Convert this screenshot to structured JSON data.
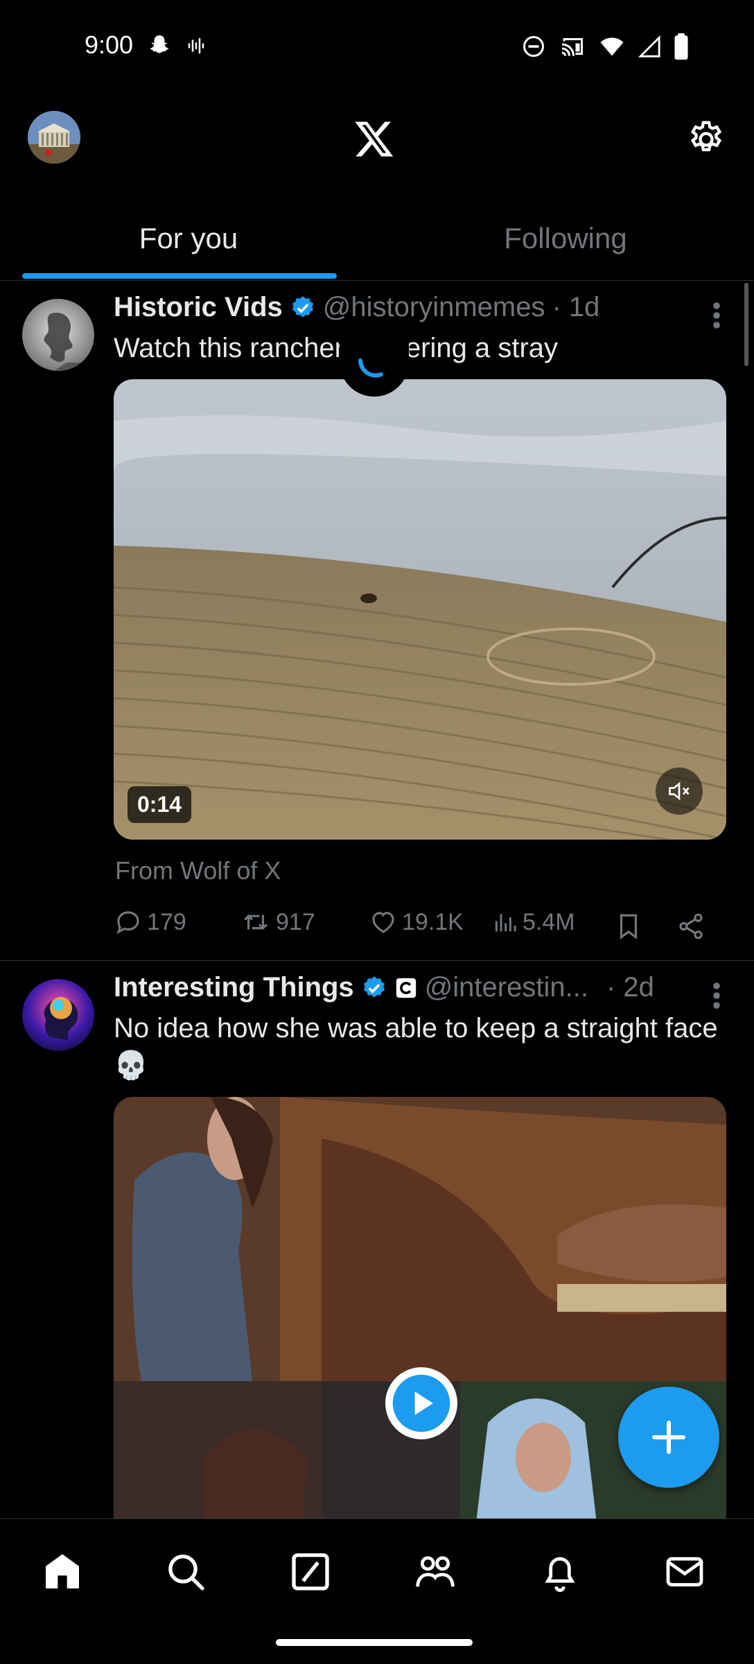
{
  "status_bar": {
    "time": "9:00"
  },
  "header": {
    "logo": "x-logo-icon",
    "settings": "gear-icon"
  },
  "tabs": [
    {
      "label": "For you",
      "active": true
    },
    {
      "label": "Following",
      "active": false
    }
  ],
  "tweets": [
    {
      "name": "Historic Vids",
      "handle": "@historyinmemes",
      "time": "· 1d",
      "text": "Watch this rancher gathering a stray",
      "media": {
        "type": "video",
        "duration": "0:14",
        "muted": true
      },
      "from": "From Wolf of X",
      "stats": {
        "replies": "179",
        "reposts": "917",
        "likes": "19.1K",
        "views": "5.4M"
      }
    },
    {
      "name": "Interesting Things",
      "handle": "@interestin...",
      "time": "· 2d",
      "text": "No idea how she was able to keep a straight face 💀",
      "media": {
        "type": "video"
      }
    }
  ],
  "colors": {
    "accent": "#1d9bf0",
    "background": "#000000",
    "secondary_text": "#71767b",
    "divider": "#2f3336"
  },
  "bottom_nav": [
    {
      "name": "home-icon",
      "active": true
    },
    {
      "name": "search-icon"
    },
    {
      "name": "grok-icon"
    },
    {
      "name": "communities-icon"
    },
    {
      "name": "notifications-icon"
    },
    {
      "name": "messages-icon"
    }
  ]
}
